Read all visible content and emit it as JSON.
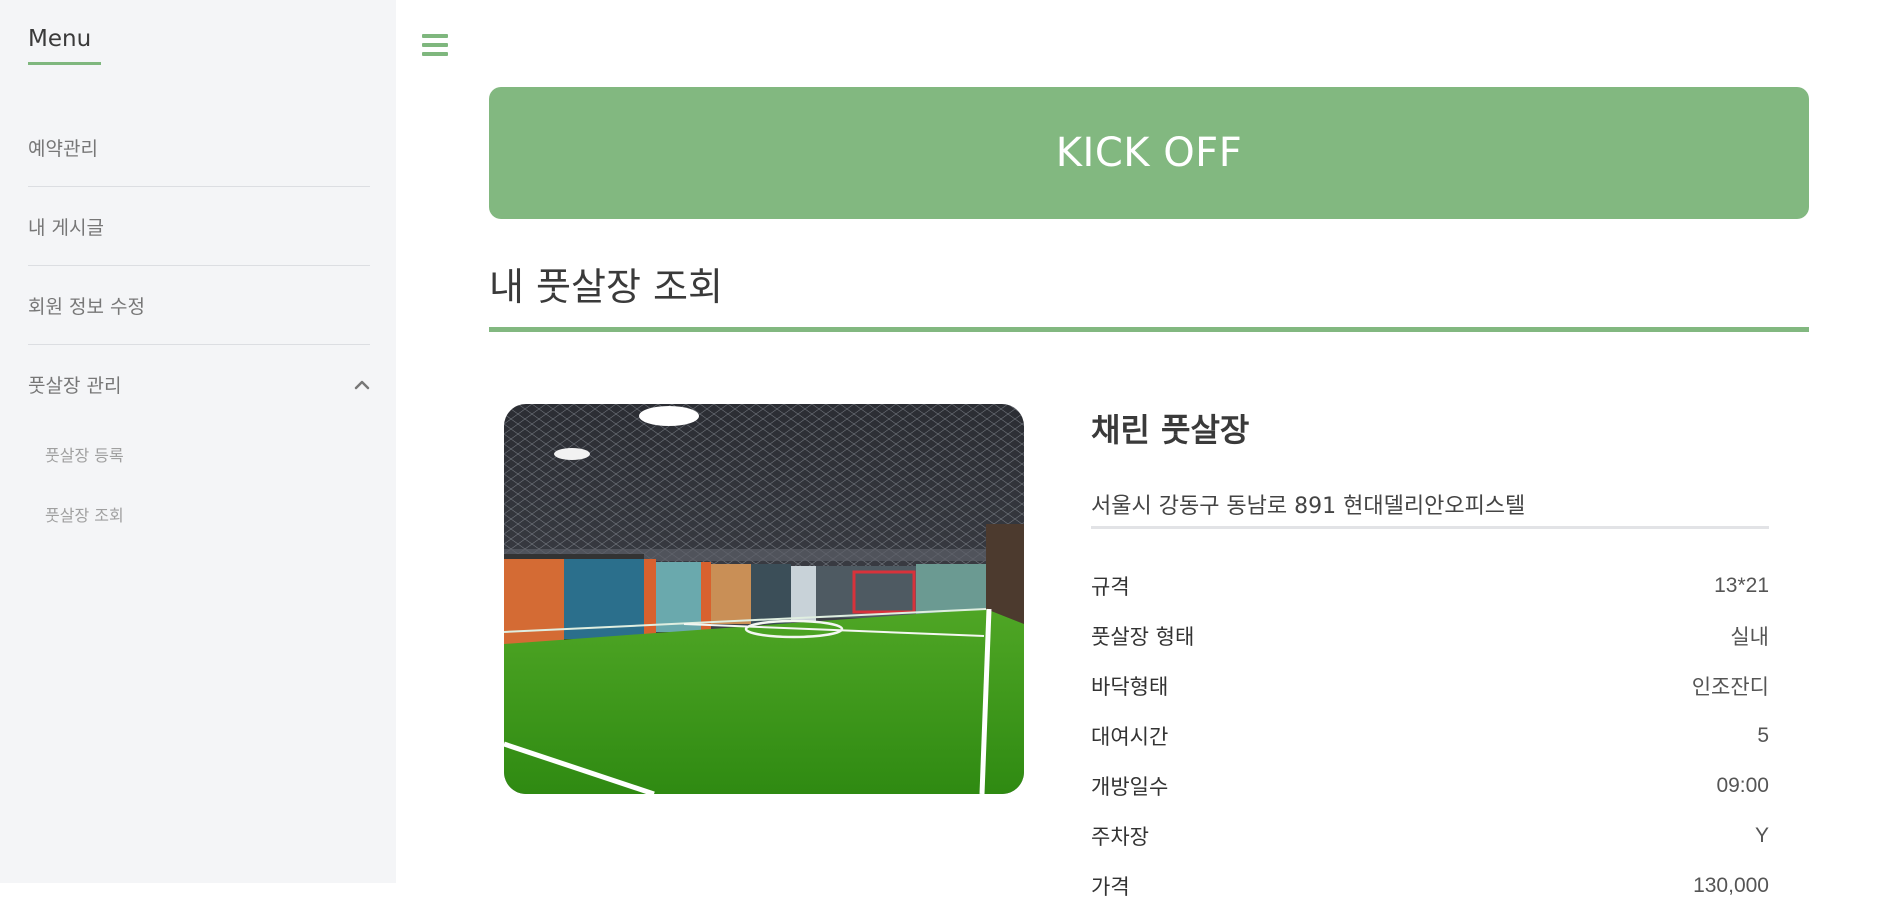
{
  "sidebar": {
    "title": "Menu",
    "items": [
      {
        "label": "예약관리"
      },
      {
        "label": "내 게시글"
      },
      {
        "label": "회원 정보 수정"
      },
      {
        "label": "풋살장 관리"
      }
    ],
    "subitems": [
      {
        "label": "풋살장 등록"
      },
      {
        "label": "풋살장 조회"
      }
    ]
  },
  "header": {
    "menu_icon": "hamburger-icon",
    "banner_text": "KICK OFF"
  },
  "page": {
    "title": "내 풋살장 조회"
  },
  "venue": {
    "name": "채린 풋살장",
    "address": "서울시 강동구 동남로 891 현대델리안오피스텔",
    "specs": [
      {
        "label": "규격",
        "value": "13*21"
      },
      {
        "label": "풋살장 형태",
        "value": "실내"
      },
      {
        "label": "바닥형태",
        "value": "인조잔디"
      },
      {
        "label": "대여시간",
        "value": "5"
      },
      {
        "label": "개방일수",
        "value": "09:00"
      },
      {
        "label": "주차장",
        "value": "Y"
      },
      {
        "label": "가격",
        "value": "130,000"
      }
    ]
  },
  "colors": {
    "accent": "#82b880",
    "sidebar_bg": "#f4f5f7"
  }
}
